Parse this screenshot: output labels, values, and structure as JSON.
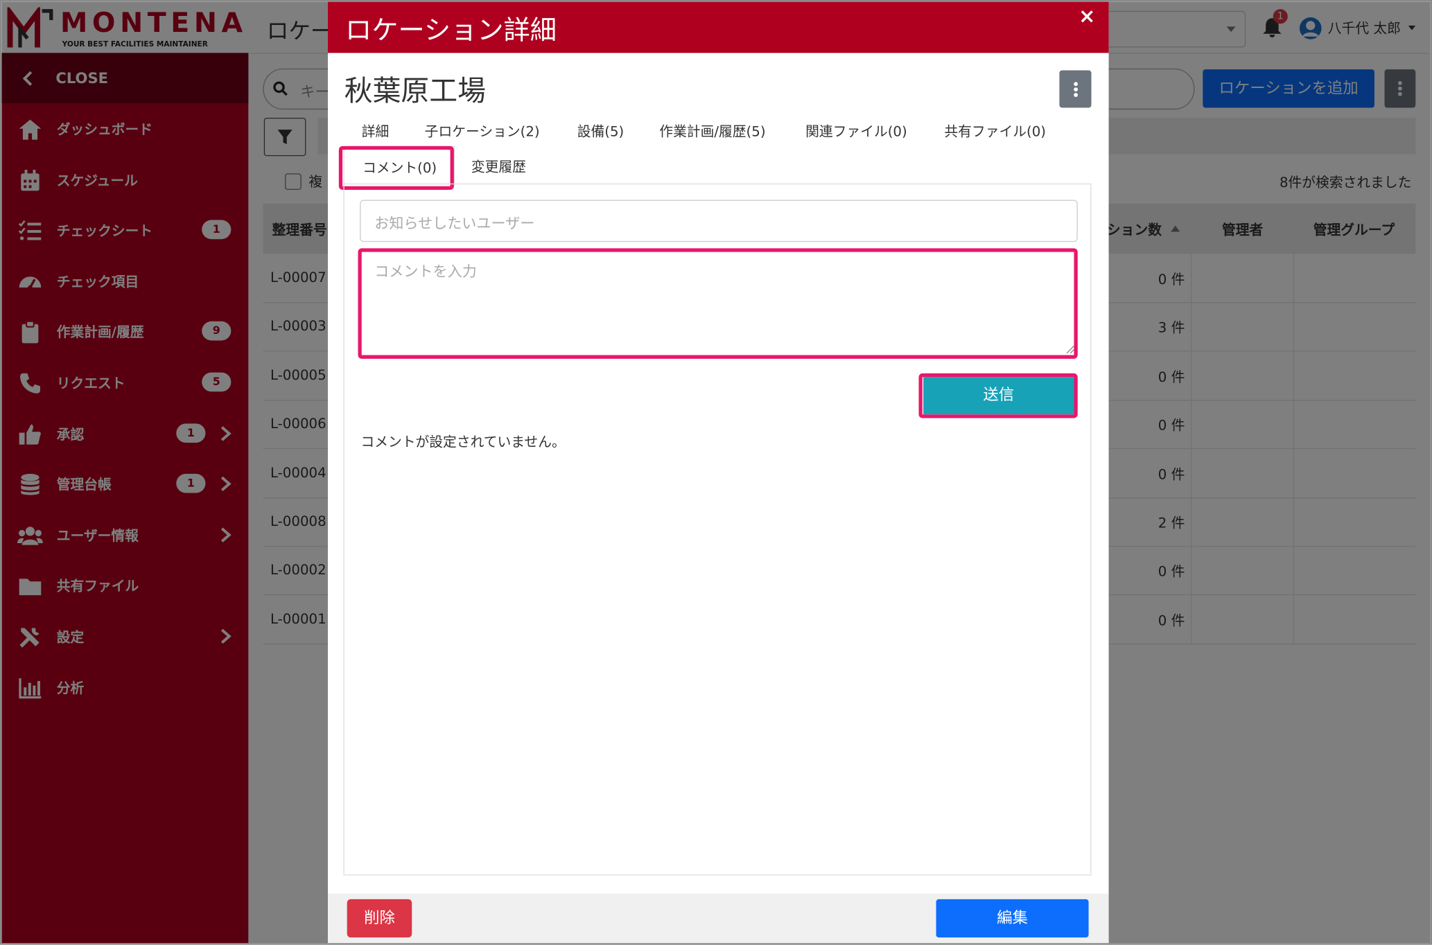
{
  "app": {
    "logo_text": "MONTENA",
    "logo_tagline": "YOUR BEST FACILITIES MAINTAINER",
    "page_title": "ロケー"
  },
  "sidebar": {
    "close_label": "CLOSE",
    "items": [
      {
        "label": "ダッシュボード",
        "icon": "home-icon",
        "badge": null,
        "chevron": false
      },
      {
        "label": "スケジュール",
        "icon": "calendar-icon",
        "badge": null,
        "chevron": false
      },
      {
        "label": "チェックシート",
        "icon": "checklist-icon",
        "badge": "1",
        "chevron": false
      },
      {
        "label": "チェック項目",
        "icon": "gauge-icon",
        "badge": null,
        "chevron": false
      },
      {
        "label": "作業計画/履歴",
        "icon": "clipboard-icon",
        "badge": "9",
        "chevron": false
      },
      {
        "label": "リクエスト",
        "icon": "phone-icon",
        "badge": "5",
        "chevron": false
      },
      {
        "label": "承認",
        "icon": "thumbs-up-icon",
        "badge": "1",
        "chevron": true
      },
      {
        "label": "管理台帳",
        "icon": "database-icon",
        "badge": "1",
        "chevron": true
      },
      {
        "label": "ユーザー情報",
        "icon": "users-icon",
        "badge": null,
        "chevron": true
      },
      {
        "label": "共有ファイル",
        "icon": "folder-icon",
        "badge": null,
        "chevron": false
      },
      {
        "label": "設定",
        "icon": "tools-icon",
        "badge": null,
        "chevron": true
      },
      {
        "label": "分析",
        "icon": "bar-chart-icon",
        "badge": null,
        "chevron": false
      }
    ]
  },
  "header": {
    "notification_count": "1",
    "user_name": "八千代 太郎"
  },
  "background": {
    "search_placeholder": "キー",
    "add_button": "ロケーションを追加",
    "checkbox_label": "複",
    "result_count": "8件が検索されました",
    "columns": {
      "id": "整理番号",
      "count": "ション数",
      "manager": "管理者",
      "group": "管理グループ"
    },
    "rows": [
      {
        "id": "L-00007",
        "count": "0 件"
      },
      {
        "id": "L-00003",
        "count": "3 件"
      },
      {
        "id": "L-00005",
        "count": "0 件"
      },
      {
        "id": "L-00006",
        "count": "0 件"
      },
      {
        "id": "L-00004",
        "count": "0 件"
      },
      {
        "id": "L-00008",
        "count": "2 件"
      },
      {
        "id": "L-00002",
        "count": "0 件"
      },
      {
        "id": "L-00001",
        "count": "0 件"
      }
    ]
  },
  "modal": {
    "title": "ロケーション詳細",
    "close_symbol": "×",
    "location_name": "秋葉原工場",
    "tabs_row1": [
      "詳細",
      "子ロケーション(2)",
      "設備(5)",
      "作業計画/履歴(5)",
      "関連ファイル(0)",
      "共有ファイル(0)"
    ],
    "tabs_row2": [
      "コメント(0)",
      "変更履歴"
    ],
    "notify_placeholder": "お知らせしたいユーザー",
    "comment_placeholder": "コメントを入力",
    "send_label": "送信",
    "empty_message": "コメントが設定されていません。",
    "delete_label": "削除",
    "edit_label": "編集"
  },
  "colors": {
    "brand_red": "#b00020",
    "sidebar_dark": "#6f0014",
    "highlight": "#e8176b",
    "teal": "#17a2b8",
    "primary": "#0d6efd",
    "danger": "#dc3545"
  }
}
